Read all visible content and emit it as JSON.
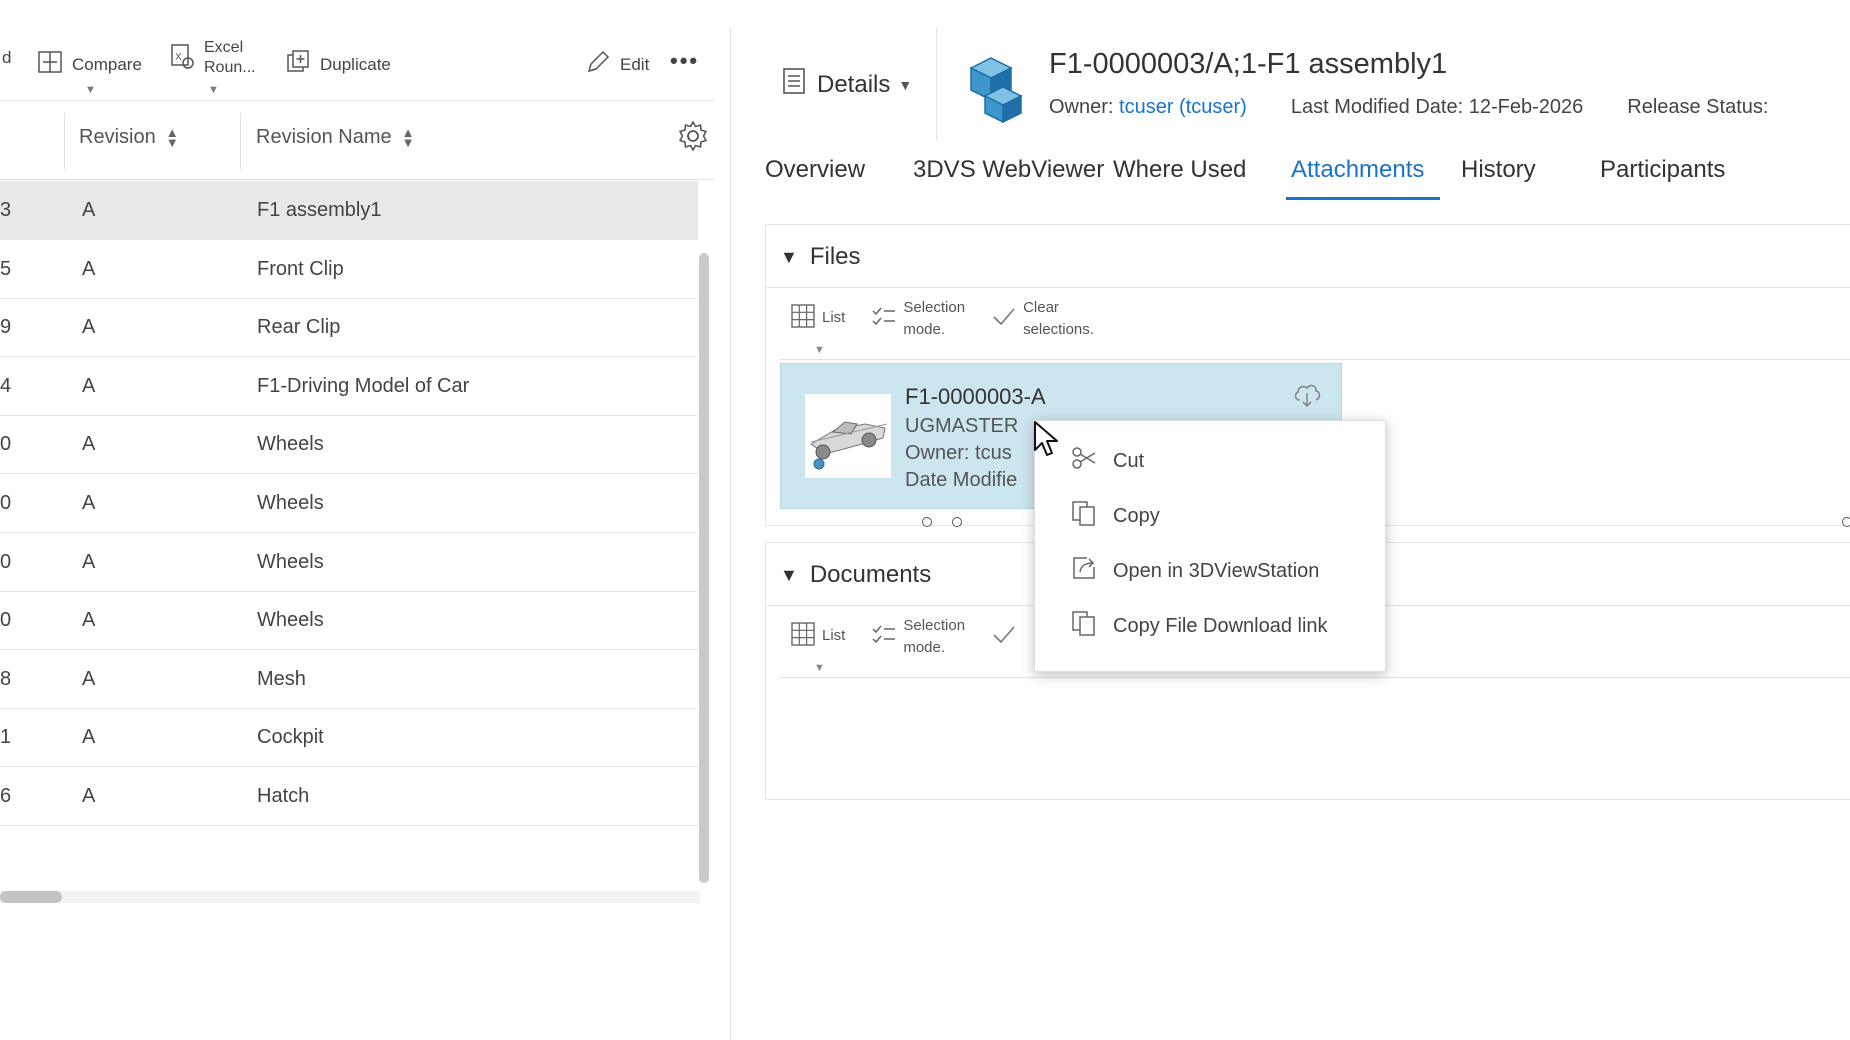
{
  "left_toolbar": {
    "partial_label": "d",
    "compare": "Compare",
    "excel_line1": "Excel",
    "excel_line2": "Roun...",
    "duplicate": "Duplicate",
    "edit": "Edit",
    "more": "•••"
  },
  "grid": {
    "col_revision": "Revision",
    "col_revision_name": "Revision Name",
    "rows": [
      {
        "id": "3",
        "rev": "A",
        "name": "F1 assembly1"
      },
      {
        "id": "5",
        "rev": "A",
        "name": "Front Clip"
      },
      {
        "id": "9",
        "rev": "A",
        "name": "Rear Clip"
      },
      {
        "id": "4",
        "rev": "A",
        "name": "F1-Driving Model of Car"
      },
      {
        "id": "0",
        "rev": "A",
        "name": "Wheels"
      },
      {
        "id": "0",
        "rev": "A",
        "name": "Wheels"
      },
      {
        "id": "0",
        "rev": "A",
        "name": "Wheels"
      },
      {
        "id": "0",
        "rev": "A",
        "name": "Wheels"
      },
      {
        "id": "8",
        "rev": "A",
        "name": "Mesh"
      },
      {
        "id": "1",
        "rev": "A",
        "name": "Cockpit"
      },
      {
        "id": "6",
        "rev": "A",
        "name": "Hatch"
      }
    ]
  },
  "header": {
    "details": "Details",
    "title": "F1-0000003/A;1-F1 assembly1",
    "owner_label": "Owner:",
    "owner_value": "tcuser (tcuser)",
    "last_modified": "Last Modified Date: 12-Feb-2026",
    "release_status": "Release Status:"
  },
  "tabs": [
    "Overview",
    "3DVS WebViewer",
    "Where Used",
    "Attachments",
    "History",
    "Participants"
  ],
  "files": {
    "title": "Files",
    "list": "List",
    "selection_1": "Selection",
    "selection_2": "mode.",
    "clear_1": "Clear",
    "clear_2": "selections.",
    "card": {
      "name": "F1-0000003-A",
      "type": "UGMASTER",
      "owner": "Owner: tcus",
      "date": "Date Modifie"
    }
  },
  "documents": {
    "title": "Documents",
    "list": "List",
    "selection_1": "Selection",
    "selection_2": "mode."
  },
  "context_menu": {
    "cut": "Cut",
    "copy": "Copy",
    "open_3dvs": "Open in 3DViewStation",
    "copy_link": "Copy File Download link"
  },
  "colors": {
    "accent": "#1a73c9",
    "card_bg": "#cce6ef",
    "selected_row": "#e8e8e8"
  }
}
